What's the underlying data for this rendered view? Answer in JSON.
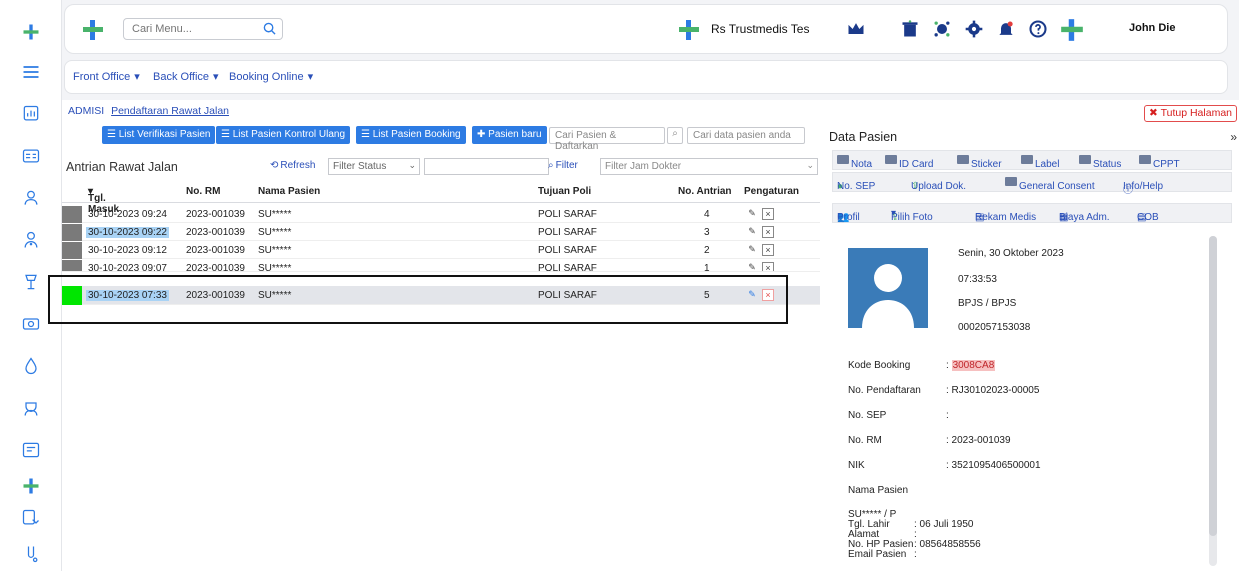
{
  "header": {
    "search_placeholder": "Cari Menu...",
    "hospital_name": "Rs Trustmedis Tes",
    "user_name": "John Die"
  },
  "nav": {
    "items": [
      {
        "label": "Front Office"
      },
      {
        "label": "Back Office"
      },
      {
        "label": "Booking Online"
      }
    ]
  },
  "breadcrumb": {
    "section": "ADMISI",
    "page": "Pendaftaran Rawat Jalan"
  },
  "close_page_label": "Tutup Halaman",
  "toolbar": {
    "btn_verifikasi": "List Verifikasi Pasien",
    "btn_kontrol": "List Pasien Kontrol Ulang",
    "btn_booking": "List Pasien Booking",
    "btn_baru": "Pasien baru",
    "search_pasien": "Cari Pasien & Daftarkan",
    "search_data": "Cari data pasien anda"
  },
  "queue": {
    "title": "Antrian Rawat Jalan",
    "refresh": "Refresh",
    "filter_status": "Filter Status",
    "filter_label": "Filter",
    "filter_jam": "Filter Jam Dokter",
    "columns": {
      "tgl": "Tgl. Masuk",
      "rm": "No. RM",
      "nama": "Nama Pasien",
      "poli": "Tujuan Poli",
      "antrian": "No. Antrian",
      "pengaturan": "Pengaturan"
    },
    "rows": [
      {
        "tgl": "30-10-2023 09:24",
        "rm": "2023-001039",
        "nama": "SU*****",
        "poli": "POLI SARAF",
        "antrian": "4"
      },
      {
        "tgl": "30-10-2023 09:22",
        "rm": "2023-001039",
        "nama": "SU*****",
        "poli": "POLI SARAF",
        "antrian": "3"
      },
      {
        "tgl": "30-10-2023 09:12",
        "rm": "2023-001039",
        "nama": "SU*****",
        "poli": "POLI SARAF",
        "antrian": "2"
      },
      {
        "tgl": "30-10-2023 09:07",
        "rm": "2023-001039",
        "nama": "SU*****",
        "poli": "POLI SARAF",
        "antrian": "1"
      },
      {
        "tgl": "30-10-2023 07:33",
        "rm": "2023-001039",
        "nama": "SU*****",
        "poli": "POLI SARAF",
        "antrian": "5"
      }
    ]
  },
  "panel": {
    "title": "Data Pasien",
    "bar1": [
      "Nota",
      "ID Card",
      "Sticker",
      "Label",
      "Status",
      "CPPT"
    ],
    "bar2": [
      "No. SEP",
      "Upload Dok.",
      "General Consent",
      "Info/Help"
    ],
    "bar3": [
      "Profil",
      "Pilih Foto",
      "Rekam Medis",
      "Biaya Adm.",
      "COB"
    ],
    "date": "Senin, 30 Oktober 2023",
    "time": "07:33:53",
    "payer": "BPJS / BPJS",
    "card_no": "0002057153038",
    "fields": {
      "kode_booking_label": "Kode Booking",
      "kode_booking": "3008CA8",
      "no_pendaftaran_label": "No. Pendaftaran",
      "no_pendaftaran": ": RJ30102023-00005",
      "no_sep_label": "No. SEP",
      "no_sep": ":",
      "no_rm_label": "No. RM",
      "no_rm": ": 2023-001039",
      "nik_label": "NIK",
      "nik": ": 3521095406500001",
      "nama_label": "Nama Pasien",
      "nama_gender": "SU***** / P",
      "tgl_lahir_label": "Tgl. Lahir",
      "tgl_lahir": ": 06 Juli 1950",
      "alamat_label": "Alamat",
      "alamat": ":",
      "hp_label": "No. HP Pasien",
      "hp": ": 08564858556",
      "email_label": "Email Pasien",
      "email": ":"
    }
  },
  "colors": {
    "brand_blue": "#2d7be3",
    "brand_green": "#49b36b",
    "row_done": "#7a7a7a",
    "row_active": "#00e600",
    "danger": "#d61f1f"
  }
}
